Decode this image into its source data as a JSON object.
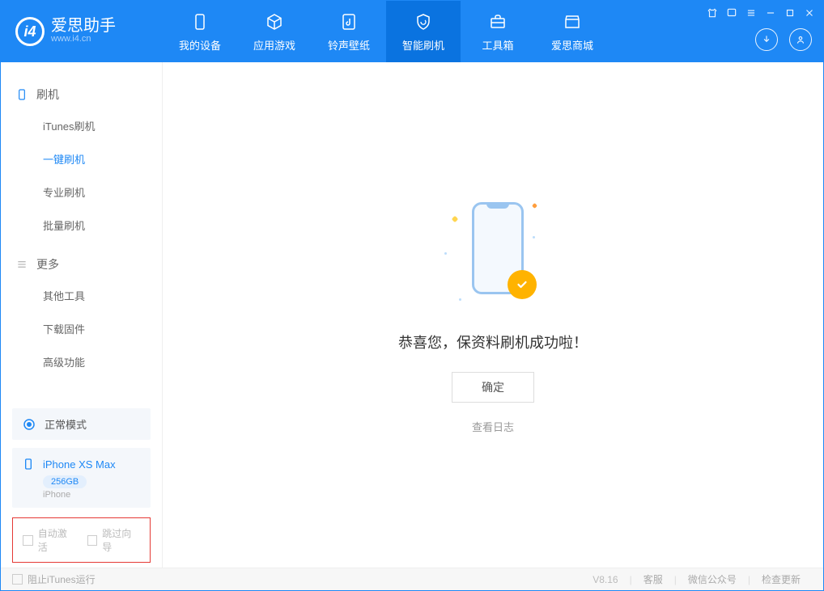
{
  "logo": {
    "title": "爱思助手",
    "url": "www.i4.cn"
  },
  "nav": [
    {
      "label": "我的设备"
    },
    {
      "label": "应用游戏"
    },
    {
      "label": "铃声壁纸"
    },
    {
      "label": "智能刷机"
    },
    {
      "label": "工具箱"
    },
    {
      "label": "爱思商城"
    }
  ],
  "sidebar": {
    "group1": {
      "header": "刷机",
      "items": [
        "iTunes刷机",
        "一键刷机",
        "专业刷机",
        "批量刷机"
      ]
    },
    "group2": {
      "header": "更多",
      "items": [
        "其他工具",
        "下载固件",
        "高级功能"
      ]
    }
  },
  "mode": {
    "label": "正常模式"
  },
  "device": {
    "name": "iPhone XS Max",
    "storage": "256GB",
    "type": "iPhone"
  },
  "options": {
    "auto_activate": "自动激活",
    "skip_guide": "跳过向导"
  },
  "main": {
    "success": "恭喜您，保资料刷机成功啦！",
    "confirm": "确定",
    "view_log": "查看日志"
  },
  "footer": {
    "block_itunes": "阻止iTunes运行",
    "version": "V8.16",
    "links": [
      "客服",
      "微信公众号",
      "检查更新"
    ]
  }
}
